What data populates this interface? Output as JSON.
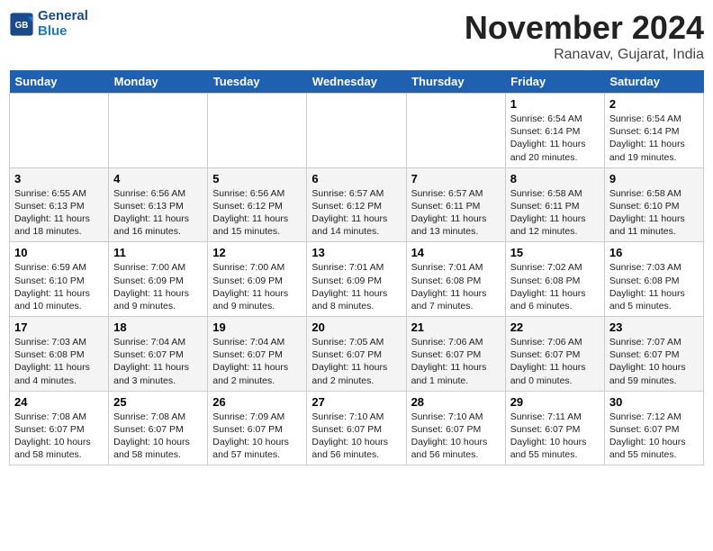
{
  "logo": {
    "line1": "General",
    "line2": "Blue"
  },
  "title": "November 2024",
  "location": "Ranavav, Gujarat, India",
  "weekdays": [
    "Sunday",
    "Monday",
    "Tuesday",
    "Wednesday",
    "Thursday",
    "Friday",
    "Saturday"
  ],
  "weeks": [
    [
      {
        "day": "",
        "info": ""
      },
      {
        "day": "",
        "info": ""
      },
      {
        "day": "",
        "info": ""
      },
      {
        "day": "",
        "info": ""
      },
      {
        "day": "",
        "info": ""
      },
      {
        "day": "1",
        "info": "Sunrise: 6:54 AM\nSunset: 6:14 PM\nDaylight: 11 hours\nand 20 minutes."
      },
      {
        "day": "2",
        "info": "Sunrise: 6:54 AM\nSunset: 6:14 PM\nDaylight: 11 hours\nand 19 minutes."
      }
    ],
    [
      {
        "day": "3",
        "info": "Sunrise: 6:55 AM\nSunset: 6:13 PM\nDaylight: 11 hours\nand 18 minutes."
      },
      {
        "day": "4",
        "info": "Sunrise: 6:56 AM\nSunset: 6:13 PM\nDaylight: 11 hours\nand 16 minutes."
      },
      {
        "day": "5",
        "info": "Sunrise: 6:56 AM\nSunset: 6:12 PM\nDaylight: 11 hours\nand 15 minutes."
      },
      {
        "day": "6",
        "info": "Sunrise: 6:57 AM\nSunset: 6:12 PM\nDaylight: 11 hours\nand 14 minutes."
      },
      {
        "day": "7",
        "info": "Sunrise: 6:57 AM\nSunset: 6:11 PM\nDaylight: 11 hours\nand 13 minutes."
      },
      {
        "day": "8",
        "info": "Sunrise: 6:58 AM\nSunset: 6:11 PM\nDaylight: 11 hours\nand 12 minutes."
      },
      {
        "day": "9",
        "info": "Sunrise: 6:58 AM\nSunset: 6:10 PM\nDaylight: 11 hours\nand 11 minutes."
      }
    ],
    [
      {
        "day": "10",
        "info": "Sunrise: 6:59 AM\nSunset: 6:10 PM\nDaylight: 11 hours\nand 10 minutes."
      },
      {
        "day": "11",
        "info": "Sunrise: 7:00 AM\nSunset: 6:09 PM\nDaylight: 11 hours\nand 9 minutes."
      },
      {
        "day": "12",
        "info": "Sunrise: 7:00 AM\nSunset: 6:09 PM\nDaylight: 11 hours\nand 9 minutes."
      },
      {
        "day": "13",
        "info": "Sunrise: 7:01 AM\nSunset: 6:09 PM\nDaylight: 11 hours\nand 8 minutes."
      },
      {
        "day": "14",
        "info": "Sunrise: 7:01 AM\nSunset: 6:08 PM\nDaylight: 11 hours\nand 7 minutes."
      },
      {
        "day": "15",
        "info": "Sunrise: 7:02 AM\nSunset: 6:08 PM\nDaylight: 11 hours\nand 6 minutes."
      },
      {
        "day": "16",
        "info": "Sunrise: 7:03 AM\nSunset: 6:08 PM\nDaylight: 11 hours\nand 5 minutes."
      }
    ],
    [
      {
        "day": "17",
        "info": "Sunrise: 7:03 AM\nSunset: 6:08 PM\nDaylight: 11 hours\nand 4 minutes."
      },
      {
        "day": "18",
        "info": "Sunrise: 7:04 AM\nSunset: 6:07 PM\nDaylight: 11 hours\nand 3 minutes."
      },
      {
        "day": "19",
        "info": "Sunrise: 7:04 AM\nSunset: 6:07 PM\nDaylight: 11 hours\nand 2 minutes."
      },
      {
        "day": "20",
        "info": "Sunrise: 7:05 AM\nSunset: 6:07 PM\nDaylight: 11 hours\nand 2 minutes."
      },
      {
        "day": "21",
        "info": "Sunrise: 7:06 AM\nSunset: 6:07 PM\nDaylight: 11 hours\nand 1 minute."
      },
      {
        "day": "22",
        "info": "Sunrise: 7:06 AM\nSunset: 6:07 PM\nDaylight: 11 hours\nand 0 minutes."
      },
      {
        "day": "23",
        "info": "Sunrise: 7:07 AM\nSunset: 6:07 PM\nDaylight: 10 hours\nand 59 minutes."
      }
    ],
    [
      {
        "day": "24",
        "info": "Sunrise: 7:08 AM\nSunset: 6:07 PM\nDaylight: 10 hours\nand 58 minutes."
      },
      {
        "day": "25",
        "info": "Sunrise: 7:08 AM\nSunset: 6:07 PM\nDaylight: 10 hours\nand 58 minutes."
      },
      {
        "day": "26",
        "info": "Sunrise: 7:09 AM\nSunset: 6:07 PM\nDaylight: 10 hours\nand 57 minutes."
      },
      {
        "day": "27",
        "info": "Sunrise: 7:10 AM\nSunset: 6:07 PM\nDaylight: 10 hours\nand 56 minutes."
      },
      {
        "day": "28",
        "info": "Sunrise: 7:10 AM\nSunset: 6:07 PM\nDaylight: 10 hours\nand 56 minutes."
      },
      {
        "day": "29",
        "info": "Sunrise: 7:11 AM\nSunset: 6:07 PM\nDaylight: 10 hours\nand 55 minutes."
      },
      {
        "day": "30",
        "info": "Sunrise: 7:12 AM\nSunset: 6:07 PM\nDaylight: 10 hours\nand 55 minutes."
      }
    ]
  ]
}
